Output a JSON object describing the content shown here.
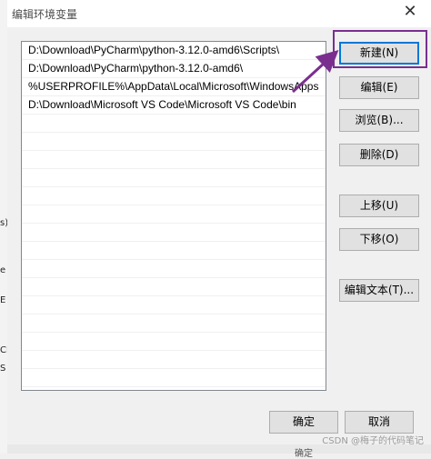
{
  "dialog": {
    "title": "编辑环境变量",
    "close_glyph": "✕"
  },
  "paths": [
    "D:\\Download\\PyCharm\\python-3.12.0-amd6\\Scripts\\",
    "D:\\Download\\PyCharm\\python-3.12.0-amd6\\",
    "%USERPROFILE%\\AppData\\Local\\Microsoft\\WindowsApps",
    "D:\\Download\\Microsoft VS Code\\Microsoft VS Code\\bin"
  ],
  "buttons": {
    "new": "新建(N)",
    "edit": "编辑(E)",
    "browse": "浏览(B)...",
    "delete": "删除(D)",
    "move_up": "上移(U)",
    "move_down": "下移(O)",
    "edit_text": "编辑文本(T)...",
    "ok": "确定",
    "cancel": "取消"
  },
  "watermark": "CSDN @梅子的代码笔记",
  "background_fragments": [
    "s)",
    "e",
    "E",
    "Cl",
    "S"
  ],
  "bottom_fragment": "确定",
  "colors": {
    "annotation": "#7a2f8f",
    "focus": "#0078d7"
  }
}
